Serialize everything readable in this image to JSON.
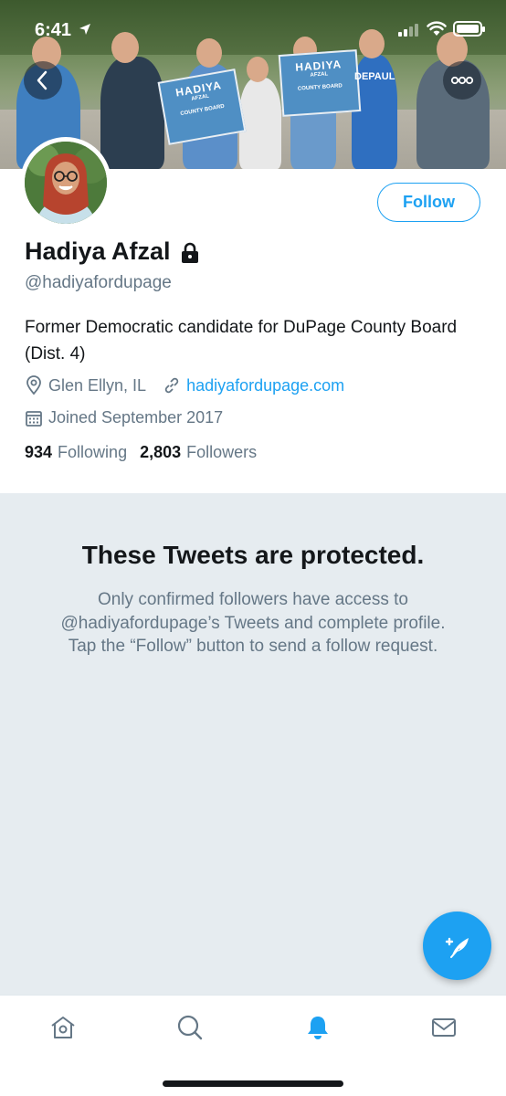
{
  "status_bar": {
    "time": "6:41"
  },
  "banner": {
    "sign_text_line1": "HADIYA",
    "sign_text_line2": "AFZAL",
    "sign_text_line3": "COUNTY BOARD",
    "shirt_text": "DEPAUL"
  },
  "profile": {
    "follow_label": "Follow",
    "name": "Hadiya Afzal",
    "handle": "@hadiyafordupage",
    "bio": "Former Democratic candidate for DuPage County Board (Dist. 4)",
    "location": "Glen Ellyn, IL",
    "website": "hadiyafordupage.com",
    "joined": "Joined September 2017",
    "following_count": "934",
    "following_label": "Following",
    "followers_count": "2,803",
    "followers_label": "Followers"
  },
  "protected": {
    "title": "These Tweets are protected.",
    "message": "Only confirmed followers have access to @hadiyafordupage’s Tweets and complete profile. Tap the “Follow” button to send a follow request."
  },
  "tabbar": {
    "active_tab": "notifications"
  },
  "colors": {
    "accent": "#1da1f2",
    "secondary_text": "#657786",
    "protected_bg": "#e6ecf0"
  }
}
